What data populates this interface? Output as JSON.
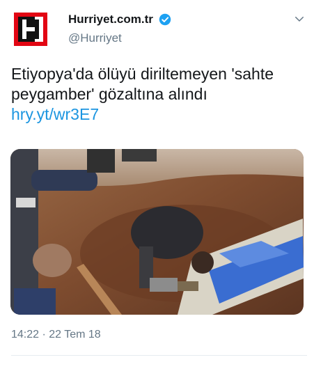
{
  "tweet": {
    "display_name": "Hurriyet.com.tr",
    "handle": "@Hurriyet",
    "text": "Etiyopya'da ölüyü diriltemeyen 'sahte peygamber' gözaltına alındı",
    "link": "hry.yt/wr3E7",
    "timestamp": "14:22 · 22 Tem 18"
  },
  "avatar": {
    "logo_letter": "H"
  },
  "icons": {
    "verified": "verified-badge-icon",
    "menu": "chevron-down-icon"
  },
  "colors": {
    "brand_red": "#e20613",
    "link_blue": "#1b95e0",
    "verified_blue": "#1da1f2",
    "muted": "#657786"
  }
}
